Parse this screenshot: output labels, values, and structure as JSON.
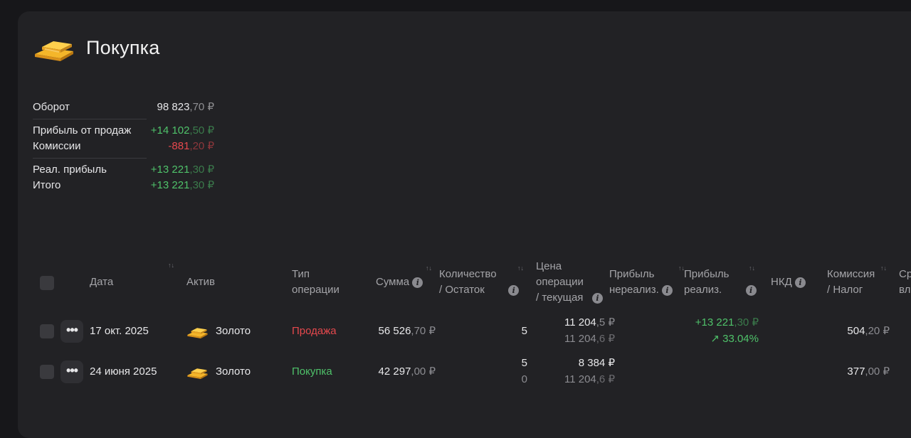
{
  "page": {
    "title": "Покупка"
  },
  "summary": {
    "turnover": {
      "label": "Оборот",
      "main": "98 823",
      "frac": ",70 ₽"
    },
    "sales_profit": {
      "label": "Прибыль от продаж",
      "main": "+14 102",
      "frac": ",50 ₽"
    },
    "commissions": {
      "label": "Комиссии",
      "main": "-881",
      "frac": ",20 ₽"
    },
    "realized_profit": {
      "label": "Реал. прибыль",
      "main": "+13 221",
      "frac": ",30 ₽"
    },
    "total": {
      "label": "Итого",
      "main": "+13 221",
      "frac": ",30 ₽"
    }
  },
  "table": {
    "headers": {
      "date": "Дата",
      "asset": "Актив",
      "op_type_1": "Тип",
      "op_type_2": "операции",
      "sum": "Сумма",
      "qty_1": "Количество",
      "qty_2": "/ Остаток",
      "price_1": "Цена",
      "price_2": "операции",
      "price_3": "/ текущая",
      "unreal_1": "Прибыль",
      "unreal_2": "нереализ.",
      "real_1": "Прибыль",
      "real_2": "реализ.",
      "nkd": "НКД",
      "comm_1": "Комиссия",
      "comm_2": "/ Налог",
      "extra_1": "Ср",
      "extra_2": "вл"
    },
    "rows": [
      {
        "date": "17 окт. 2025",
        "asset": "Золото",
        "op_type": "Продажа",
        "sum_main": "56 526",
        "sum_frac": ",70 ₽",
        "qty": "5",
        "qty_rest": "",
        "price_main": "11 204",
        "price_frac": ",5 ₽",
        "price_cur_main": "11 204",
        "price_cur_frac": ",6 ₽",
        "real_main": "+13 221",
        "real_frac": ",30 ₽",
        "real_pct": "↗ 33.04%",
        "comm_main": "504",
        "comm_frac": ",20 ₽"
      },
      {
        "date": "24 июня 2025",
        "asset": "Золото",
        "op_type": "Покупка",
        "sum_main": "42 297",
        "sum_frac": ",00 ₽",
        "qty": "5",
        "qty_rest": "0",
        "price_main": "8 384",
        "price_frac": " ₽",
        "price_cur_main": "11 204",
        "price_cur_frac": ",6 ₽",
        "comm_main": "377",
        "comm_frac": ",00 ₽"
      }
    ]
  },
  "colors": {
    "positive": "#4fc26a",
    "negative": "#e5484d",
    "background": "#222225"
  }
}
